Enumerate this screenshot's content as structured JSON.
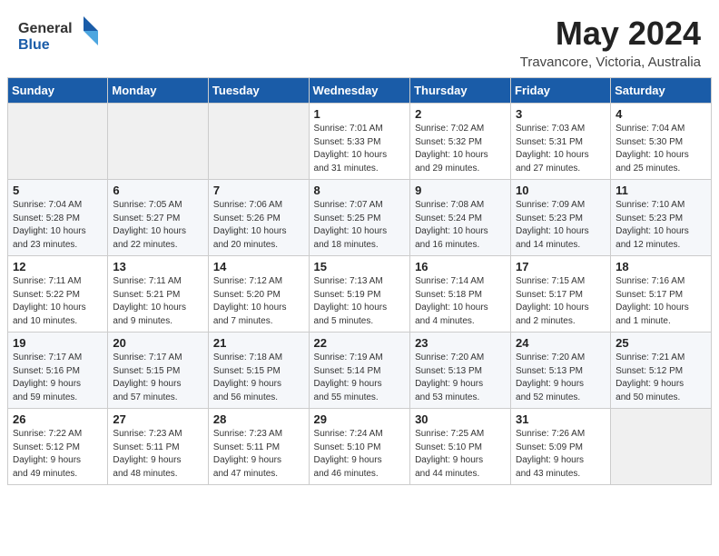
{
  "header": {
    "logo_general": "General",
    "logo_blue": "Blue",
    "month_year": "May 2024",
    "location": "Travancore, Victoria, Australia"
  },
  "days_of_week": [
    "Sunday",
    "Monday",
    "Tuesday",
    "Wednesday",
    "Thursday",
    "Friday",
    "Saturday"
  ],
  "weeks": [
    [
      {
        "day": "",
        "info": ""
      },
      {
        "day": "",
        "info": ""
      },
      {
        "day": "",
        "info": ""
      },
      {
        "day": "1",
        "info": "Sunrise: 7:01 AM\nSunset: 5:33 PM\nDaylight: 10 hours\nand 31 minutes."
      },
      {
        "day": "2",
        "info": "Sunrise: 7:02 AM\nSunset: 5:32 PM\nDaylight: 10 hours\nand 29 minutes."
      },
      {
        "day": "3",
        "info": "Sunrise: 7:03 AM\nSunset: 5:31 PM\nDaylight: 10 hours\nand 27 minutes."
      },
      {
        "day": "4",
        "info": "Sunrise: 7:04 AM\nSunset: 5:30 PM\nDaylight: 10 hours\nand 25 minutes."
      }
    ],
    [
      {
        "day": "5",
        "info": "Sunrise: 7:04 AM\nSunset: 5:28 PM\nDaylight: 10 hours\nand 23 minutes."
      },
      {
        "day": "6",
        "info": "Sunrise: 7:05 AM\nSunset: 5:27 PM\nDaylight: 10 hours\nand 22 minutes."
      },
      {
        "day": "7",
        "info": "Sunrise: 7:06 AM\nSunset: 5:26 PM\nDaylight: 10 hours\nand 20 minutes."
      },
      {
        "day": "8",
        "info": "Sunrise: 7:07 AM\nSunset: 5:25 PM\nDaylight: 10 hours\nand 18 minutes."
      },
      {
        "day": "9",
        "info": "Sunrise: 7:08 AM\nSunset: 5:24 PM\nDaylight: 10 hours\nand 16 minutes."
      },
      {
        "day": "10",
        "info": "Sunrise: 7:09 AM\nSunset: 5:23 PM\nDaylight: 10 hours\nand 14 minutes."
      },
      {
        "day": "11",
        "info": "Sunrise: 7:10 AM\nSunset: 5:23 PM\nDaylight: 10 hours\nand 12 minutes."
      }
    ],
    [
      {
        "day": "12",
        "info": "Sunrise: 7:11 AM\nSunset: 5:22 PM\nDaylight: 10 hours\nand 10 minutes."
      },
      {
        "day": "13",
        "info": "Sunrise: 7:11 AM\nSunset: 5:21 PM\nDaylight: 10 hours\nand 9 minutes."
      },
      {
        "day": "14",
        "info": "Sunrise: 7:12 AM\nSunset: 5:20 PM\nDaylight: 10 hours\nand 7 minutes."
      },
      {
        "day": "15",
        "info": "Sunrise: 7:13 AM\nSunset: 5:19 PM\nDaylight: 10 hours\nand 5 minutes."
      },
      {
        "day": "16",
        "info": "Sunrise: 7:14 AM\nSunset: 5:18 PM\nDaylight: 10 hours\nand 4 minutes."
      },
      {
        "day": "17",
        "info": "Sunrise: 7:15 AM\nSunset: 5:17 PM\nDaylight: 10 hours\nand 2 minutes."
      },
      {
        "day": "18",
        "info": "Sunrise: 7:16 AM\nSunset: 5:17 PM\nDaylight: 10 hours\nand 1 minute."
      }
    ],
    [
      {
        "day": "19",
        "info": "Sunrise: 7:17 AM\nSunset: 5:16 PM\nDaylight: 9 hours\nand 59 minutes."
      },
      {
        "day": "20",
        "info": "Sunrise: 7:17 AM\nSunset: 5:15 PM\nDaylight: 9 hours\nand 57 minutes."
      },
      {
        "day": "21",
        "info": "Sunrise: 7:18 AM\nSunset: 5:15 PM\nDaylight: 9 hours\nand 56 minutes."
      },
      {
        "day": "22",
        "info": "Sunrise: 7:19 AM\nSunset: 5:14 PM\nDaylight: 9 hours\nand 55 minutes."
      },
      {
        "day": "23",
        "info": "Sunrise: 7:20 AM\nSunset: 5:13 PM\nDaylight: 9 hours\nand 53 minutes."
      },
      {
        "day": "24",
        "info": "Sunrise: 7:20 AM\nSunset: 5:13 PM\nDaylight: 9 hours\nand 52 minutes."
      },
      {
        "day": "25",
        "info": "Sunrise: 7:21 AM\nSunset: 5:12 PM\nDaylight: 9 hours\nand 50 minutes."
      }
    ],
    [
      {
        "day": "26",
        "info": "Sunrise: 7:22 AM\nSunset: 5:12 PM\nDaylight: 9 hours\nand 49 minutes."
      },
      {
        "day": "27",
        "info": "Sunrise: 7:23 AM\nSunset: 5:11 PM\nDaylight: 9 hours\nand 48 minutes."
      },
      {
        "day": "28",
        "info": "Sunrise: 7:23 AM\nSunset: 5:11 PM\nDaylight: 9 hours\nand 47 minutes."
      },
      {
        "day": "29",
        "info": "Sunrise: 7:24 AM\nSunset: 5:10 PM\nDaylight: 9 hours\nand 46 minutes."
      },
      {
        "day": "30",
        "info": "Sunrise: 7:25 AM\nSunset: 5:10 PM\nDaylight: 9 hours\nand 44 minutes."
      },
      {
        "day": "31",
        "info": "Sunrise: 7:26 AM\nSunset: 5:09 PM\nDaylight: 9 hours\nand 43 minutes."
      },
      {
        "day": "",
        "info": ""
      }
    ]
  ]
}
